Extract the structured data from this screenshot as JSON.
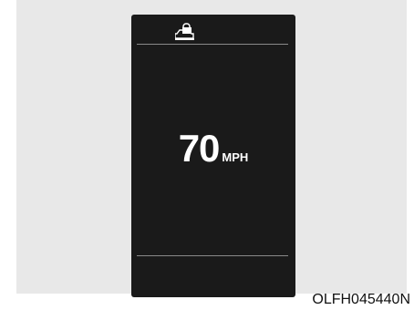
{
  "display": {
    "icon": "vehicle-with-lock-icon",
    "speed_value": "70",
    "speed_unit": "MPH",
    "background_color": "#1a1a1a",
    "text_color": "#ffffff"
  },
  "caption": "OLFH045440N"
}
